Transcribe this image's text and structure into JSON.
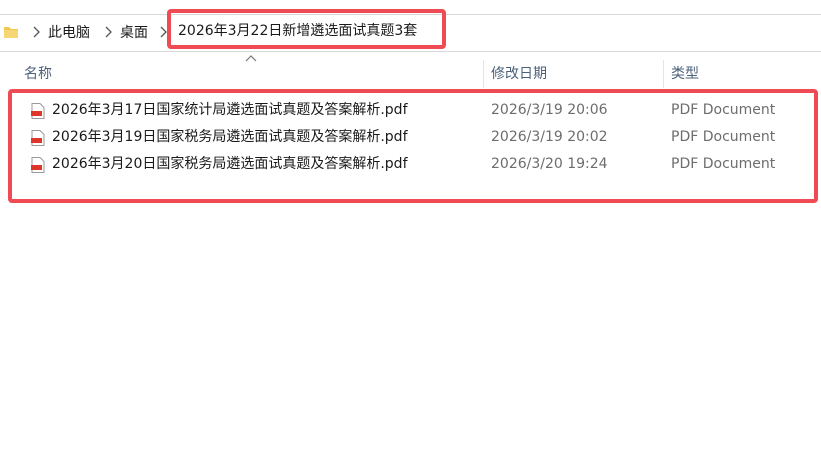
{
  "breadcrumb": {
    "items": [
      "此电脑",
      "桌面"
    ],
    "current": "2026年3月22日新增遴选面试真题3套"
  },
  "columns": {
    "name": "名称",
    "modified": "修改日期",
    "type": "类型"
  },
  "files": [
    {
      "name": "2026年3月17日国家统计局遴选面试真题及答案解析.pdf",
      "modified": "2026/3/19 20:06",
      "type": "PDF Document"
    },
    {
      "name": "2026年3月19日国家税务局遴选面试真题及答案解析.pdf",
      "modified": "2026/3/19 20:02",
      "type": "PDF Document"
    },
    {
      "name": "2026年3月20日国家税务局遴选面试真题及答案解析.pdf",
      "modified": "2026/3/20 19:24",
      "type": "PDF Document"
    }
  ],
  "colors": {
    "highlight": "#ee4b55",
    "header_text": "#4c607a",
    "folder": "#f2c94c"
  },
  "icons": {
    "folder": "folder-icon",
    "separator": "chevron-right-icon",
    "file": "pdf-file-icon",
    "sort": "sort-ascending-icon"
  }
}
